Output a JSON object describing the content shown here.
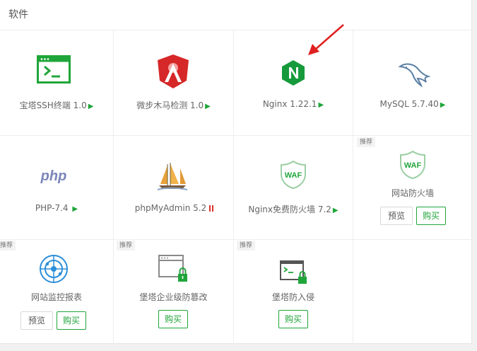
{
  "panel": {
    "title": "软件"
  },
  "apps": [
    {
      "name": "宝塔SSH终端 1.0",
      "status": "play",
      "icon": "terminal-window-icon"
    },
    {
      "name": "微步木马检测 1.0",
      "status": "play",
      "icon": "threatbook-shield-icon"
    },
    {
      "name": "Nginx 1.22.1",
      "status": "play",
      "icon": "nginx-hexagon-icon"
    },
    {
      "name": "MySQL 5.7.40",
      "status": "play",
      "icon": "mysql-dolphin-icon"
    },
    {
      "name": "PHP-7.4",
      "status": "play",
      "icon": "php-logo-icon"
    },
    {
      "name": "phpMyAdmin 5.2",
      "status": "pause",
      "icon": "phpmyadmin-sailboat-icon"
    },
    {
      "name": "Nginx免费防火墙 7.2",
      "status": "play",
      "icon": "waf-shield-icon"
    }
  ],
  "recommended": [
    {
      "badge": "推荐",
      "name": "网站防火墙",
      "preview_label": "预览",
      "buy_label": "购买",
      "icon": "waf-shield-icon"
    },
    {
      "badge": "推荐",
      "name": "网站监控报表",
      "preview_label": "预览",
      "buy_label": "购买",
      "icon": "monitor-radar-icon"
    },
    {
      "badge": "推荐",
      "name": "堡塔企业级防篡改",
      "buy_label": "购买",
      "icon": "locked-window-icon"
    },
    {
      "badge": "推荐",
      "name": "堡塔防入侵",
      "buy_label": "购买",
      "icon": "locked-terminal-icon"
    }
  ],
  "glyphs": {
    "play": "▶"
  },
  "colors": {
    "accent": "#20a53a",
    "alert": "#d9312a",
    "nginx": "#169a3c",
    "php": "#7a86b8"
  }
}
